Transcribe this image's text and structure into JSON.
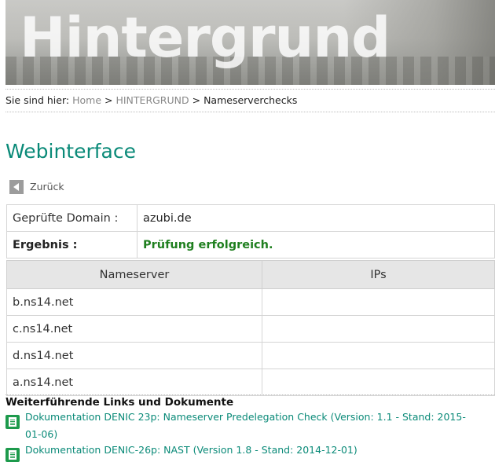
{
  "banner": {
    "title": "Hintergrund"
  },
  "breadcrumb": {
    "prefix": "Sie sind hier:",
    "items": [
      "Home",
      "HINTERGRUND",
      "Nameserverchecks"
    ],
    "separator": ">"
  },
  "page": {
    "title": "Webinterface",
    "back_label": "Zurück"
  },
  "info": {
    "domain_label": "Geprüfte Domain :",
    "domain_value": "azubi.de",
    "result_label": "Ergebnis :",
    "result_value": "Prüfung erfolgreich."
  },
  "ns_table": {
    "headers": [
      "Nameserver",
      "IPs"
    ],
    "rows": [
      {
        "nameserver": "b.ns14.net",
        "ips": ""
      },
      {
        "nameserver": "c.ns14.net",
        "ips": ""
      },
      {
        "nameserver": "d.ns14.net",
        "ips": ""
      },
      {
        "nameserver": "a.ns14.net",
        "ips": ""
      }
    ]
  },
  "links": {
    "heading": "Weiterführende Links und Dokumente",
    "items": [
      "Dokumentation DENIC 23p: Nameserver Predelegation Check (Version: 1.1 - Stand: 2015-01-06)",
      "Dokumentation DENIC-26p: NAST (Version 1.8 - Stand: 2014-12-01)"
    ]
  },
  "colors": {
    "accent": "#0a8a78",
    "success": "#1f7f1f"
  }
}
